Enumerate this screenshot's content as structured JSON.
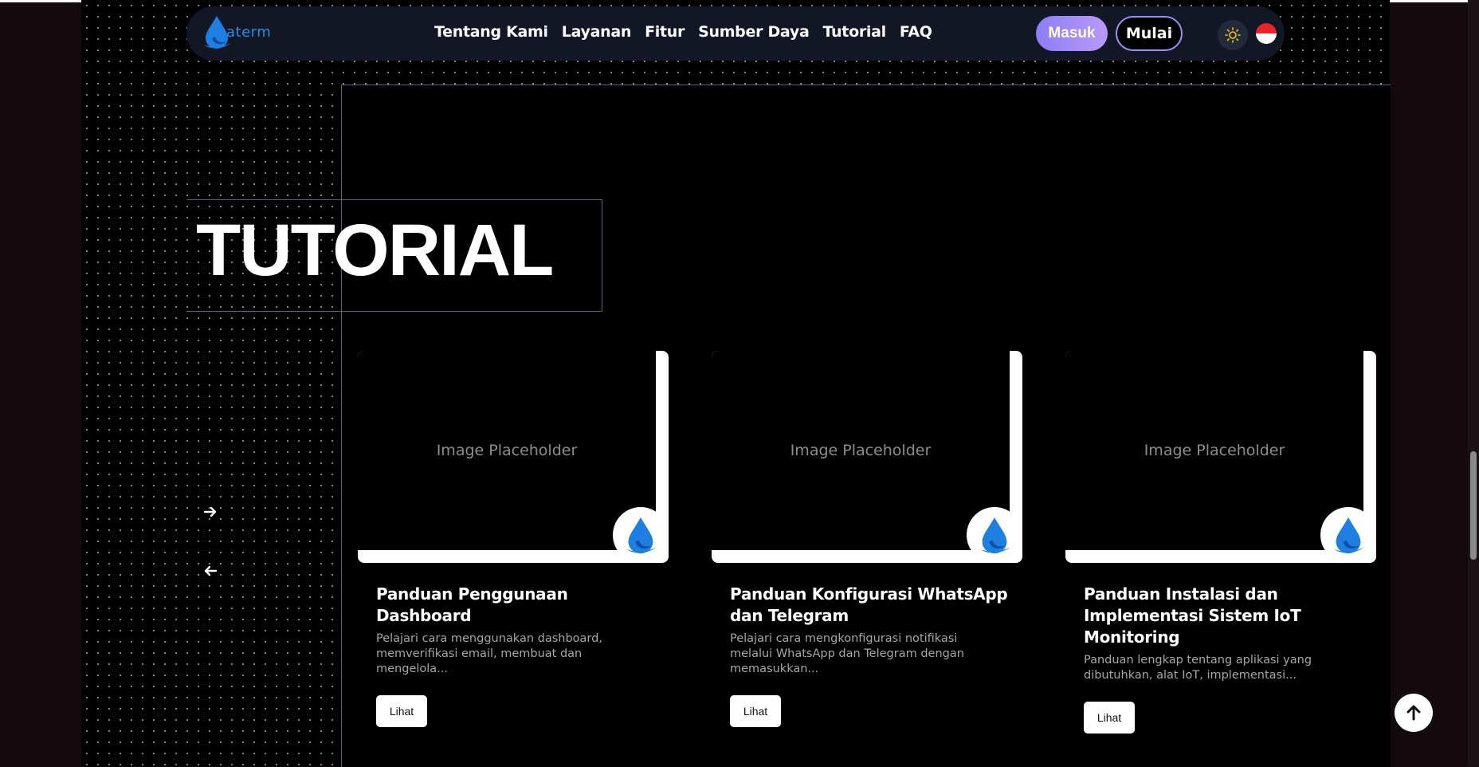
{
  "brand": {
    "logo_text": "aterm",
    "logo_icon": "water-drop-icon"
  },
  "nav": {
    "links": [
      "Tentang Kami",
      "Layanan",
      "Fitur",
      "Sumber Daya",
      "Tutorial",
      "FAQ"
    ],
    "login_label": "Masuk",
    "start_label": "Mulai",
    "theme_icon": "sun-icon",
    "language_flag": "indonesia-flag"
  },
  "section": {
    "title": "TUTORIAL"
  },
  "carousel": {
    "next_icon": "arrow-right-icon",
    "prev_icon": "arrow-left-icon"
  },
  "cards": [
    {
      "placeholder": "Image Placeholder",
      "title": "Panduan Penggunaan Dashboard",
      "description": "Pelajari cara menggunakan dashboard, memverifikasi email, membuat dan mengelola...",
      "button": "Lihat"
    },
    {
      "placeholder": "Image Placeholder",
      "title": "Panduan Konfigurasi WhatsApp dan Telegram",
      "description": "Pelajari cara mengkonfigurasi notifikasi melalui WhatsApp dan Telegram dengan memasukkan...",
      "button": "Lihat"
    },
    {
      "placeholder": "Image Placeholder",
      "title": "Panduan Instalasi dan Implementasi Sistem IoT Monitoring",
      "description": "Panduan lengkap tentang aplikasi yang dibutuhkan, alat IoT, implementasi...",
      "button": "Lihat"
    }
  ],
  "colors": {
    "accent": "#9d8ff7",
    "brand_blue": "#1f8ae6",
    "navbar": "#121725"
  }
}
